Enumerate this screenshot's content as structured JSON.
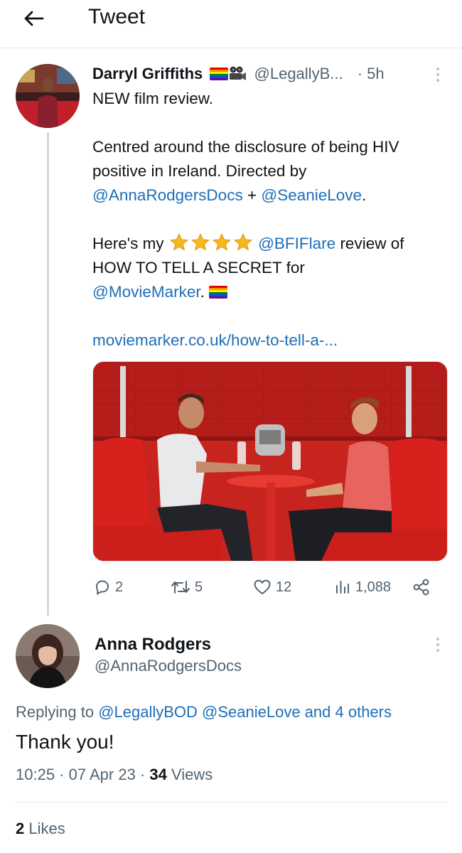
{
  "header": {
    "title": "Tweet",
    "back_icon": "arrow-left-icon"
  },
  "tweet": {
    "author_name": "Darryl Griffiths",
    "author_badges": [
      "rainbow-flag",
      "movie-camera"
    ],
    "handle": "@LegallyB...",
    "separator": "·",
    "time": "5h",
    "lines": {
      "l1": "NEW film review.",
      "l2a": "Centred around the disclosure of being HIV",
      "l2b": "positive in Ireland. Directed by",
      "l3_mention1": "@AnnaRodgersDocs",
      "l3_plus": " + ",
      "l3_mention2": "@SeanieLove",
      "l3_end": ".",
      "l4_start": "Here's my ",
      "l4_stars": 4,
      "l4_mention": "@BFIFlare",
      "l4_end": " review of",
      "l5": "HOW TO TELL A SECRET for",
      "l6_mention": "@MovieMarker",
      "l6_end": ". ",
      "url": "moviemarker.co.uk/how-to-tell-a-..."
    },
    "media": {
      "description_icon": "film-still-image"
    },
    "actions": {
      "replies": "2",
      "retweets": "5",
      "likes": "12",
      "views": "1,088"
    }
  },
  "reply": {
    "author_name": "Anna Rodgers",
    "handle": "@AnnaRodgersDocs",
    "replying_prefix": "Replying to ",
    "replying_to": "@LegallyBOD @SeanieLove and 4 others",
    "text": "Thank you!",
    "time": "10:25",
    "date": "07 Apr 23",
    "views_count": "34",
    "views_label": " Views",
    "likes_count": "2",
    "likes_label": " Likes"
  },
  "colors": {
    "link": "#1d6fb8",
    "secondary_text": "#536471",
    "primary_text": "#0f1419",
    "thread_line": "#cfd9de",
    "star": "#f5b820"
  }
}
